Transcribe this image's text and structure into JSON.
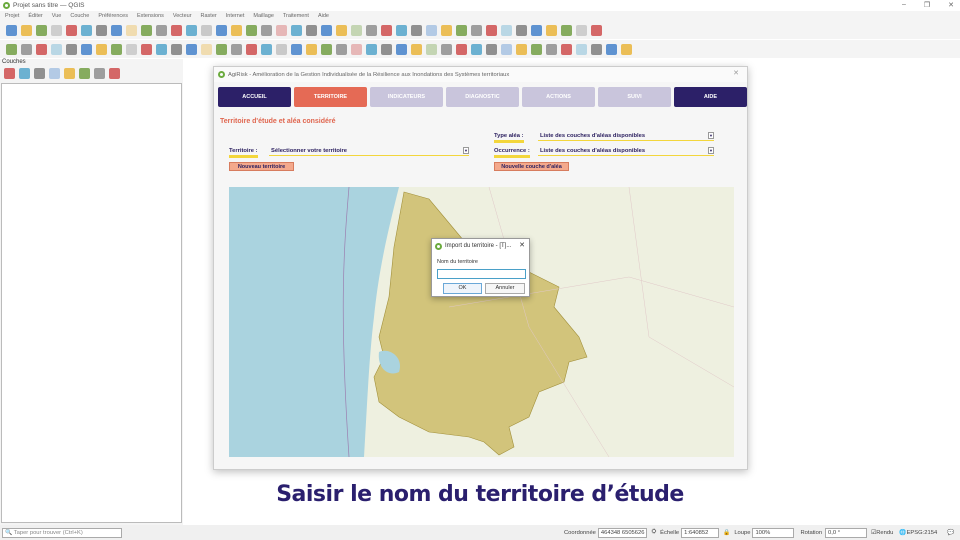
{
  "window": {
    "title": "Projet sans titre — QGIS",
    "controls": [
      "–",
      "❐",
      "✕"
    ]
  },
  "menu": [
    "Projet",
    "Éditer",
    "Vue",
    "Couche",
    "Préférences",
    "Extensions",
    "Vecteur",
    "Raster",
    "Internet",
    "Maillage",
    "Traitement",
    "Aide"
  ],
  "layers_panel": {
    "title": "Couches"
  },
  "plugin": {
    "title": "AgiRisk - Amélioration de la Gestion Individualisée de la Résilience aux Inondations des Systèmes territoriaux",
    "tabs": [
      {
        "label": "ACCUEIL",
        "color": "#2c2068"
      },
      {
        "label": "TERRITOIRE",
        "color": "#e56a55"
      },
      {
        "label": "INDICATEURS",
        "color": "#c9c5dc"
      },
      {
        "label": "DIAGNOSTIC",
        "color": "#c9c5dc"
      },
      {
        "label": "ACTIONS",
        "color": "#c9c5dc"
      },
      {
        "label": "SUIVI",
        "color": "#c9c5dc"
      },
      {
        "label": "AIDE",
        "color": "#2c2068"
      }
    ],
    "section_title": "Territoire d'étude et aléa considéré",
    "territoire_label": "Territoire :",
    "territoire_value": "Sélectionner votre territoire",
    "type_alea_label": "Type aléa :",
    "type_alea_value": "Liste des couches d'aléas disponibles",
    "occurrence_label": "Occurrence :",
    "occurrence_value": "Liste des couches d'aléas disponibles",
    "new_territory": "Nouveau territoire",
    "new_hazard": "Nouvelle couche d'aléa"
  },
  "import_dialog": {
    "title": "Import du territoire - [T]...",
    "field_label": "Nom du territoire",
    "value": "",
    "ok": "OK",
    "cancel": "Annuler"
  },
  "caption": "Saisir le nom du territoire d’étude",
  "status": {
    "search_placeholder": "Taper pour trouver (Ctrl+K)",
    "coord_label": "Coordonnée",
    "coord": "464348 6505626",
    "scale_label": "Échelle",
    "scale": "1:640852",
    "magnifier_label": "Loupe",
    "magnifier": "100%",
    "rotation_label": "Rotation",
    "rotation": "0,0 °",
    "render_label": "Rendu",
    "crs": "EPSG:2154"
  }
}
